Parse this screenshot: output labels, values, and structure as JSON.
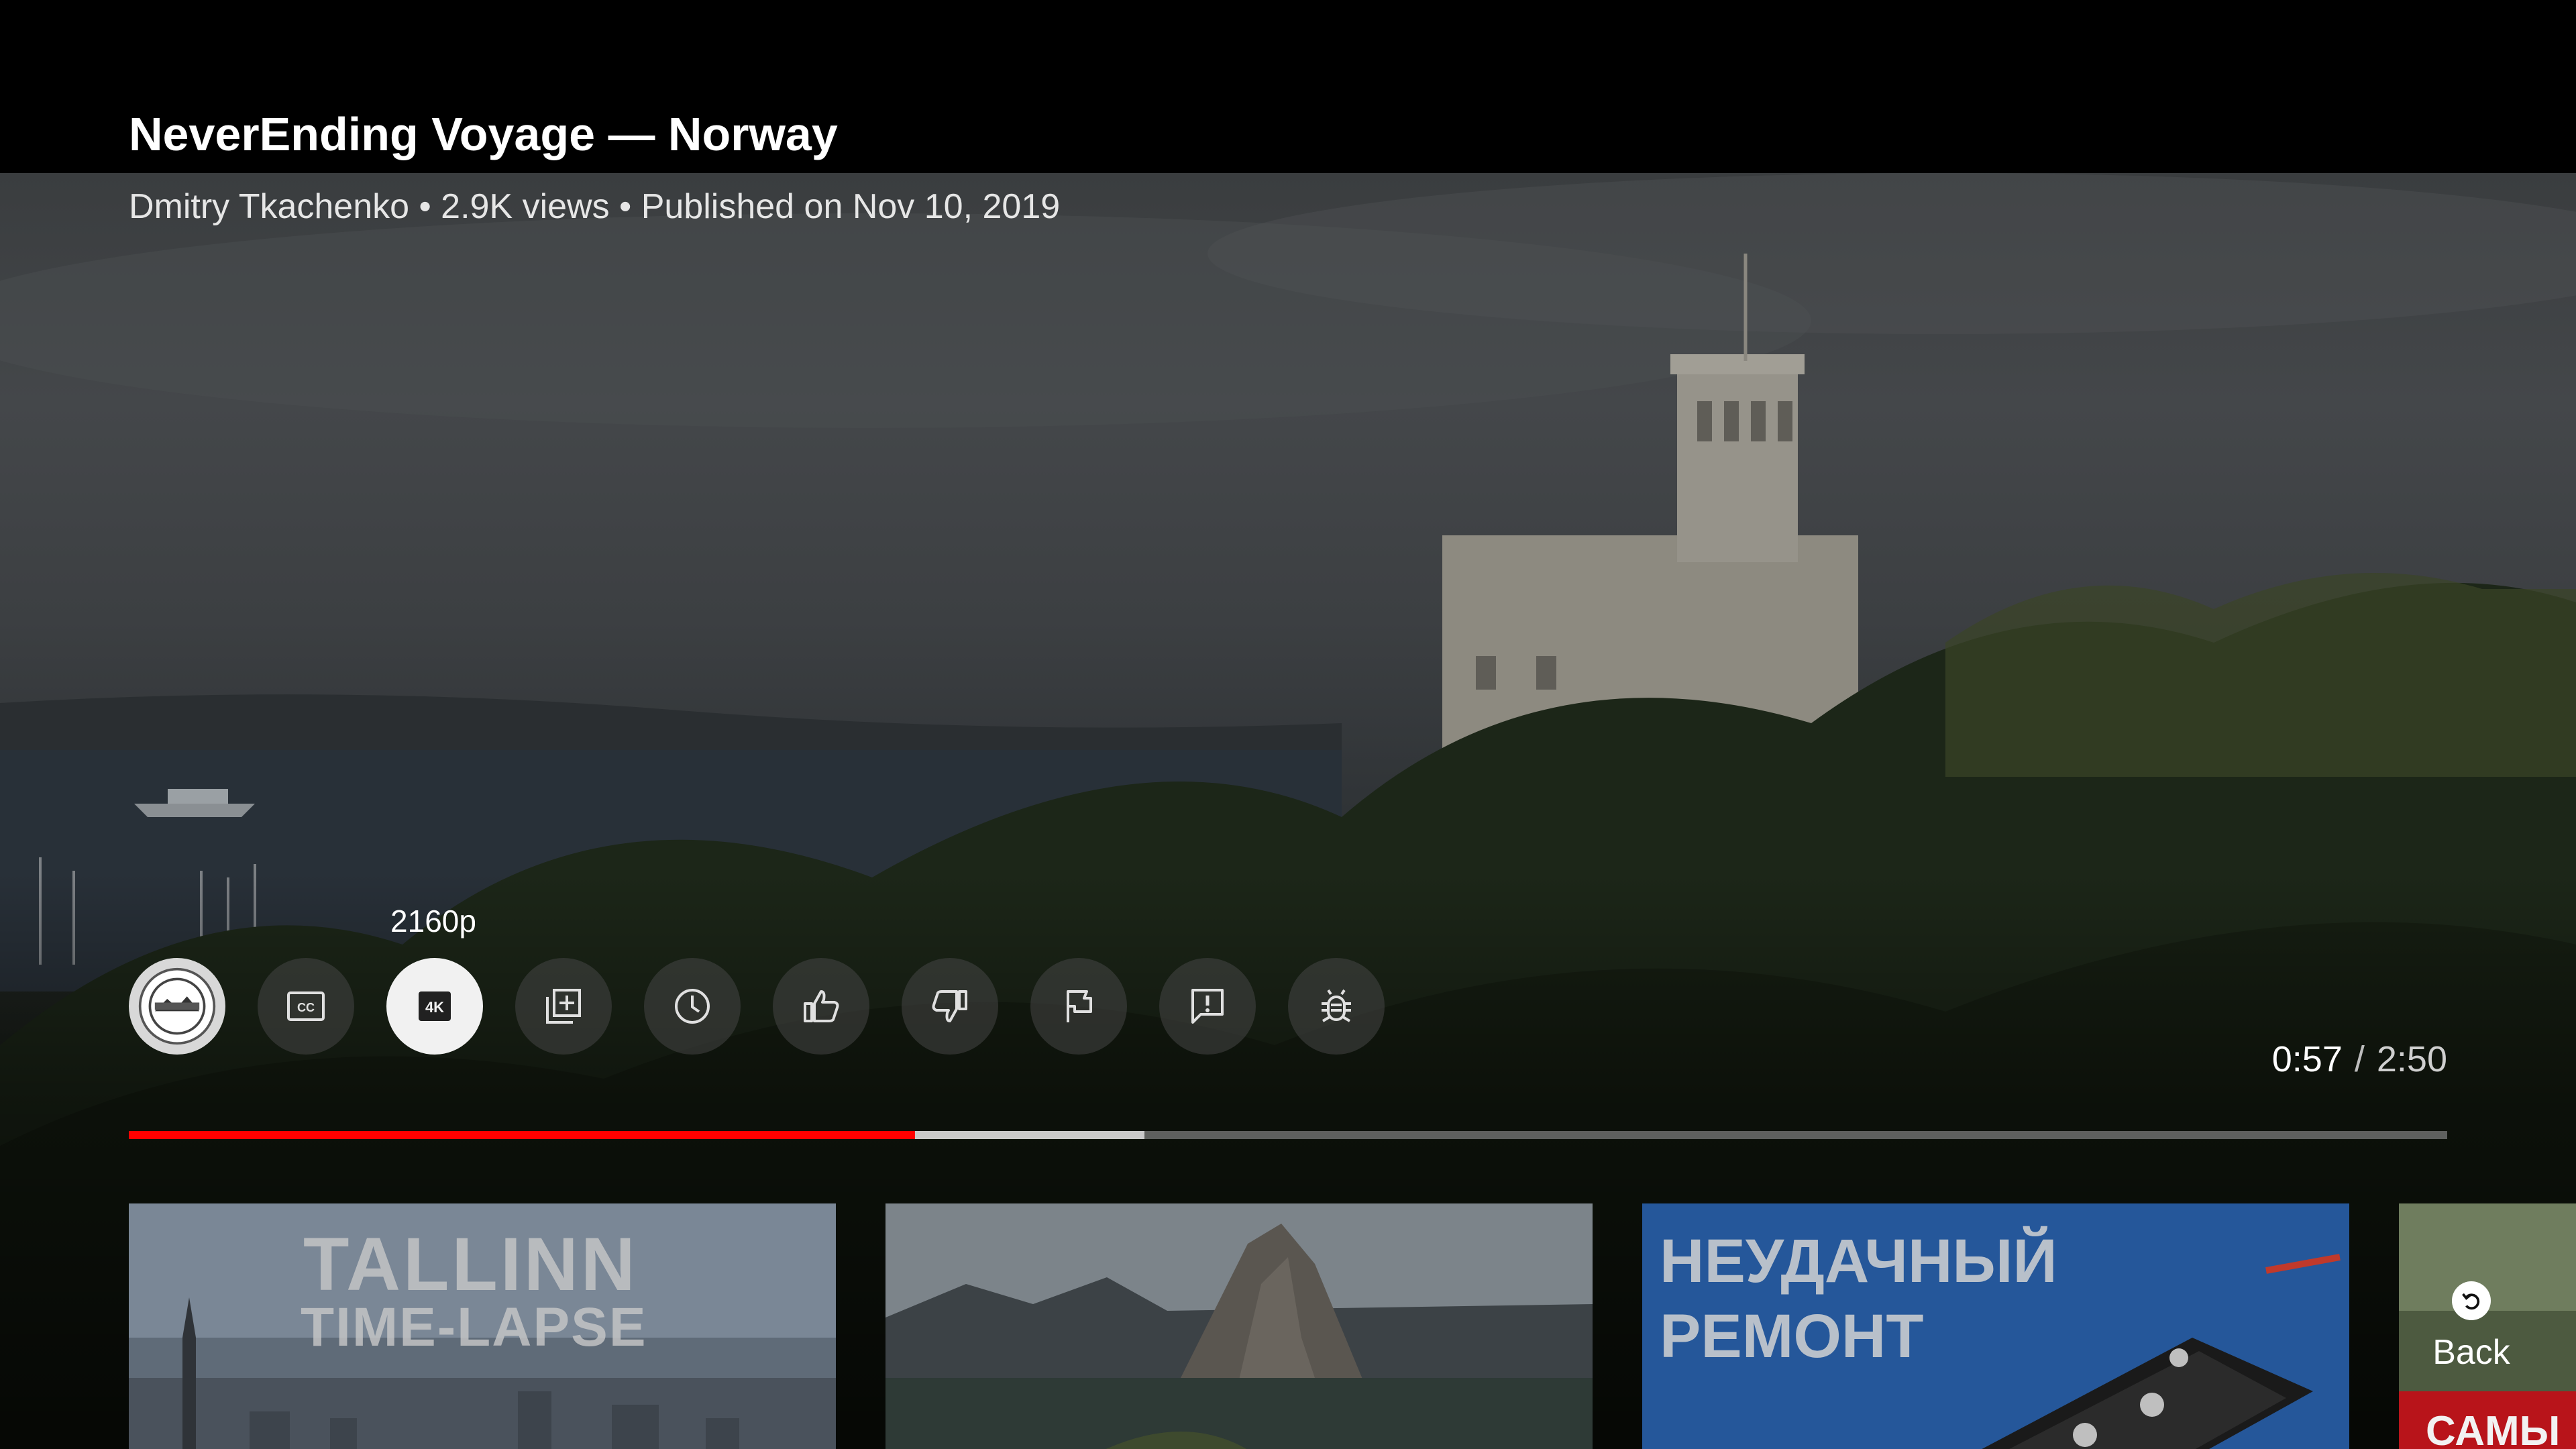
{
  "video": {
    "title": "NeverEnding Voyage — Norway",
    "meta": "Dmitry Tkachenko • 2.9K views • Published on Nov 10, 2019"
  },
  "controls": {
    "focused_tooltip": "2160p",
    "quality_label": "4K",
    "cc_label": "CC",
    "items": [
      {
        "name": "channel-avatar",
        "icon": "channel-logo-icon"
      },
      {
        "name": "subtitles",
        "icon": "cc-icon"
      },
      {
        "name": "quality",
        "icon": "4k-icon"
      },
      {
        "name": "add-to-playlist",
        "icon": "playlist-add-icon"
      },
      {
        "name": "watch-later",
        "icon": "clock-icon"
      },
      {
        "name": "like",
        "icon": "thumbs-up-icon"
      },
      {
        "name": "dislike",
        "icon": "thumbs-down-icon"
      },
      {
        "name": "report",
        "icon": "flag-icon"
      },
      {
        "name": "feedback",
        "icon": "feedback-icon"
      },
      {
        "name": "debug-info",
        "icon": "bug-icon"
      }
    ]
  },
  "playback": {
    "current_time": "0:57",
    "separator": "/",
    "total_time": "2:50",
    "played_fraction": 0.339,
    "buffered_fraction": 0.438
  },
  "suggestions": [
    {
      "title_line1": "TALLINN",
      "title_line2": "TIME-LAPSE"
    },
    {
      "title_line1": "",
      "title_line2": ""
    },
    {
      "title_line1": "НЕУДАЧНЫЙ",
      "title_line2": "РЕМОНТ"
    },
    {
      "title_line1": "САМЫ",
      "title_line2": ""
    }
  ],
  "back": {
    "label": "Back"
  },
  "colors": {
    "progress_played": "#ff0000",
    "focused_button": "#f1f1f1"
  }
}
